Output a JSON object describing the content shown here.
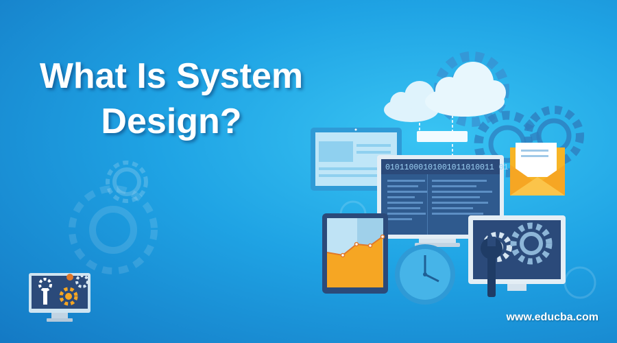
{
  "title_lines": [
    "What Is System",
    "Design?"
  ],
  "binary_text": "01011000101001011010011 01",
  "website": "www.educba.com",
  "colors": {
    "background_light": "#39c4f3",
    "background_dark": "#1479c4",
    "screen_dark": "#2b4a7a",
    "accent_orange": "#f6a623",
    "gear_blue": "#2e7fc0",
    "cloud": "#dff3fc"
  }
}
